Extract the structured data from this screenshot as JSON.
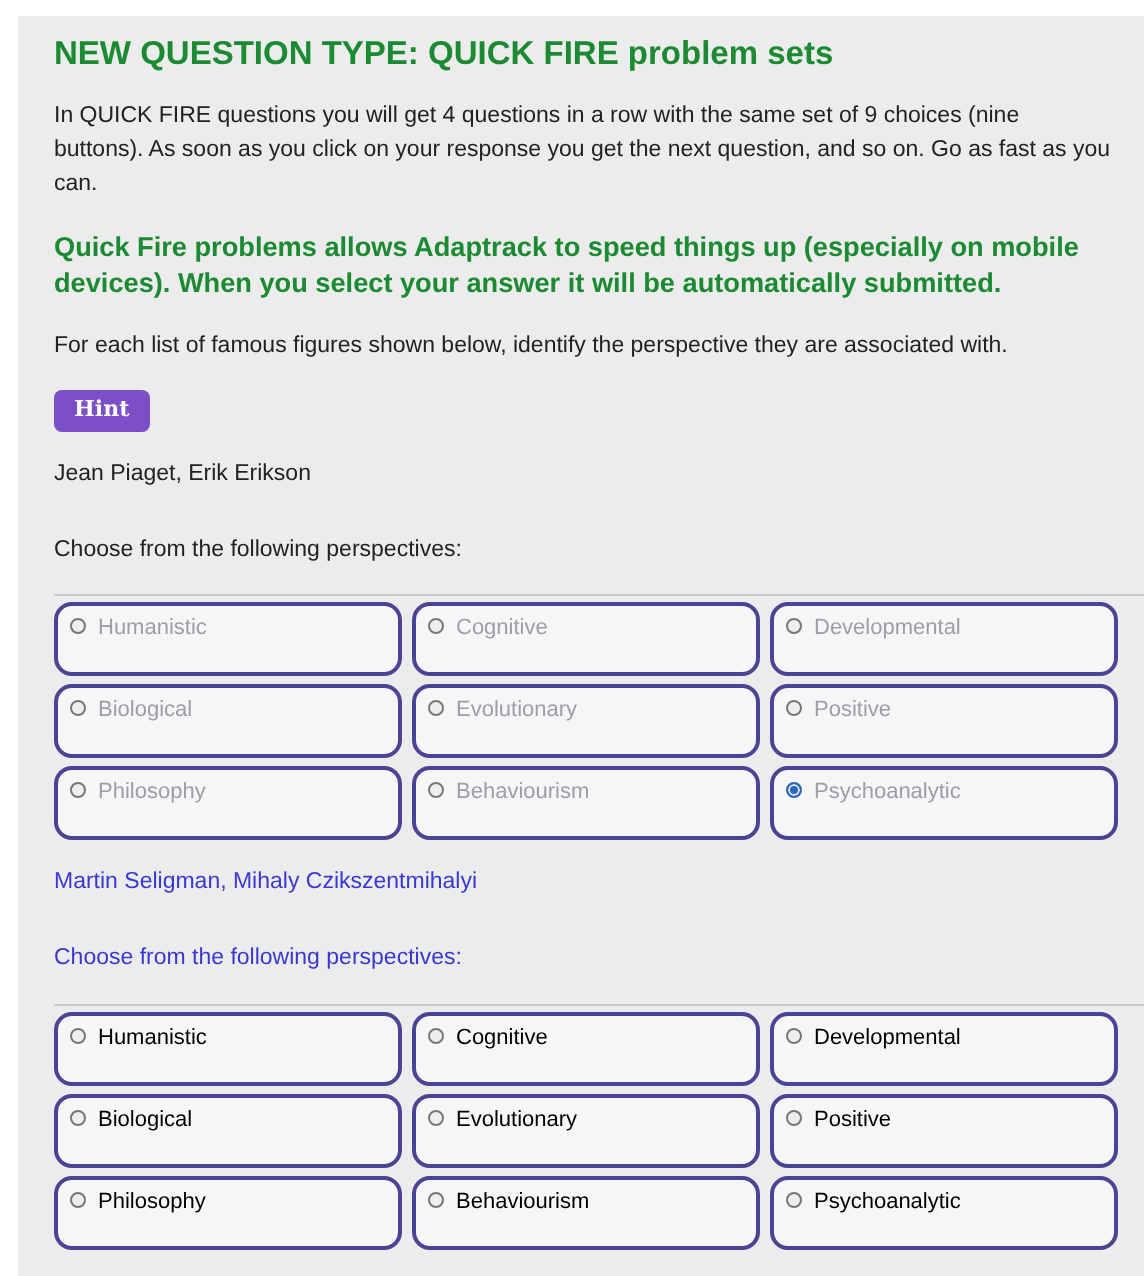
{
  "heading": "NEW QUESTION TYPE: QUICK FIRE problem sets",
  "intro": "In QUICK FIRE questions you will get 4 questions in a row with the same set of 9 choices (nine buttons). As soon as you click on your response you get the next question, and so on. Go as fast as you can.",
  "highlight": "Quick Fire problems allows Adaptrack to speed things up (especially on mobile devices). When you select your answer it will be automatically submitted.",
  "instruction": "For each list of famous figures shown below, identify the perspective they are associated with.",
  "hint_button": "Hint",
  "questions": [
    {
      "figures": "Jean Piaget, Erik Erikson",
      "prompt": "Choose from the following perspectives:",
      "active": false,
      "choices": [
        {
          "label": "Humanistic",
          "selected": false
        },
        {
          "label": "Cognitive",
          "selected": false
        },
        {
          "label": "Developmental",
          "selected": false
        },
        {
          "label": "Biological",
          "selected": false
        },
        {
          "label": "Evolutionary",
          "selected": false
        },
        {
          "label": "Positive",
          "selected": false
        },
        {
          "label": "Philosophy",
          "selected": false
        },
        {
          "label": "Behaviourism",
          "selected": false
        },
        {
          "label": "Psychoanalytic",
          "selected": true
        }
      ]
    },
    {
      "figures": "Martin Seligman, Mihaly Czikszentmihalyi",
      "prompt": "Choose from the following perspectives:",
      "active": true,
      "choices": [
        {
          "label": "Humanistic",
          "selected": false
        },
        {
          "label": "Cognitive",
          "selected": false
        },
        {
          "label": "Developmental",
          "selected": false
        },
        {
          "label": "Biological",
          "selected": false
        },
        {
          "label": "Evolutionary",
          "selected": false
        },
        {
          "label": "Positive",
          "selected": false
        },
        {
          "label": "Philosophy",
          "selected": false
        },
        {
          "label": "Behaviourism",
          "selected": false
        },
        {
          "label": "Psychoanalytic",
          "selected": false
        }
      ]
    }
  ]
}
